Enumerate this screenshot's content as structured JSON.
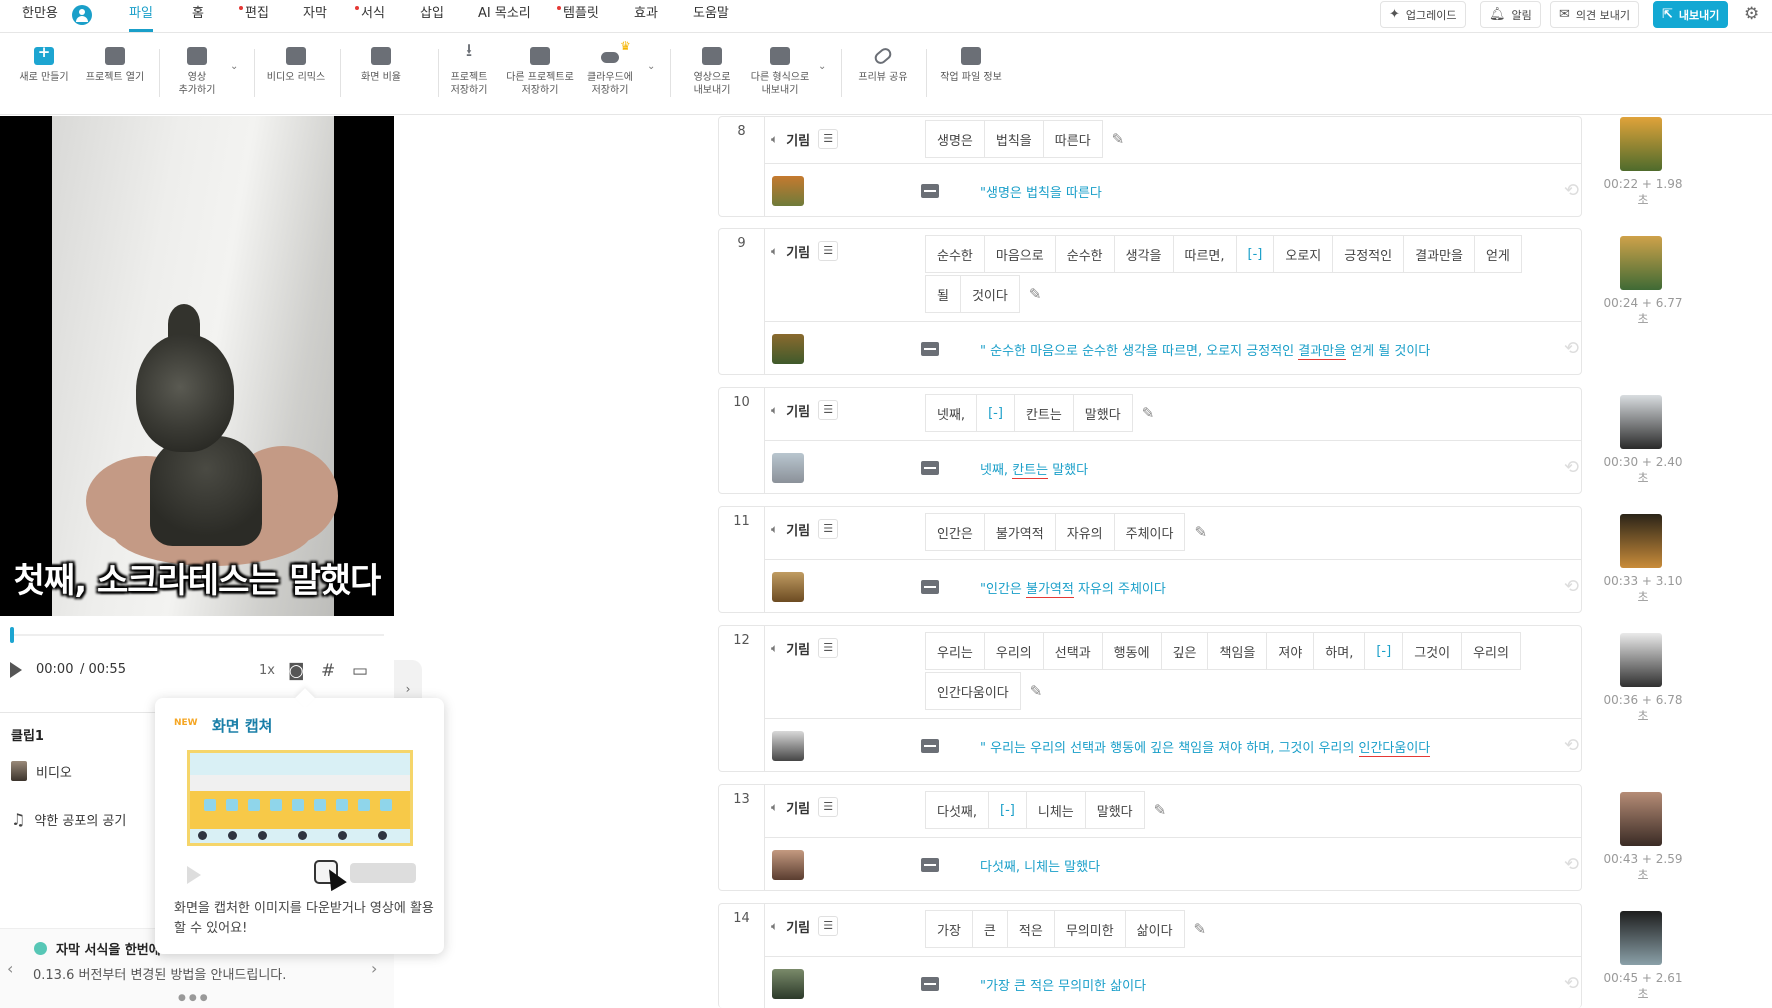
{
  "menubar": {
    "app_label": "한만용",
    "items": [
      {
        "label": "파일",
        "active": true,
        "dot": false
      },
      {
        "label": "홈",
        "active": false,
        "dot": false
      },
      {
        "label": "편집",
        "active": false,
        "dot": true
      },
      {
        "label": "자막",
        "active": false,
        "dot": false
      },
      {
        "label": "서식",
        "active": false,
        "dot": true
      },
      {
        "label": "삽입",
        "active": false,
        "dot": false
      },
      {
        "label": "AI 목소리",
        "active": false,
        "dot": false
      },
      {
        "label": "템플릿",
        "active": false,
        "dot": true
      },
      {
        "label": "효과",
        "active": false,
        "dot": false
      },
      {
        "label": "도움말",
        "active": false,
        "dot": false
      }
    ],
    "upgrade_label": "업그레이드",
    "alert_label": "알림",
    "feedback_label": "의견 보내기",
    "export_label": "내보내기"
  },
  "toolbar": {
    "new": "새로 만들기",
    "open": "프로젝트 열기",
    "add_video_1": "영상",
    "add_video_2": "추가하기",
    "video_remix": "비디오 리믹스",
    "screen_ratio": "화면 비율",
    "save_1": "프로젝트",
    "save_2": "저장하기",
    "save_as_1": "다른 프로젝트로",
    "save_as_2": "저장하기",
    "cloud_1": "클라우드에",
    "cloud_2": "저장하기",
    "export_video_1": "영상으로",
    "export_video_2": "내보내기",
    "export_other_1": "다른 형식으로",
    "export_other_2": "내보내기",
    "preview_share": "프리뷰 공유",
    "file_info": "작업 파일 정보"
  },
  "player": {
    "caption": "첫째, 소크라테스는 말했다",
    "current_time": "00:00",
    "total_time": "/ 00:55",
    "speed": "1x",
    "progress": 0.0
  },
  "clips": {
    "title": "클립1",
    "video_label": "비디오",
    "music_label": "약한 공포의 공기"
  },
  "notice": {
    "title": "자막 서식을 한번에",
    "text": "0.13.6 버전부터 변경된 방법을 안내드립니다."
  },
  "popover": {
    "badge": "NEW",
    "title": "화면 캡쳐",
    "desc": "화면을 캡처한 이미지를 다운받거나 영상에 활용할 수 있어요!"
  },
  "scenes": [
    {
      "num": "8",
      "voice": "기림",
      "lines": [
        [
          "생명은",
          "법칙을",
          "따른다"
        ]
      ],
      "subtitle": "\"생명은 법칙을 따른다",
      "time": "00:22 + 1.98초"
    },
    {
      "num": "9",
      "voice": "기림",
      "lines": [
        [
          "순수한",
          "마음으로",
          "순수한",
          "생각을",
          "따르면,",
          "[-]",
          "오로지",
          "긍정적인",
          "결과만을",
          "얻게"
        ],
        [
          "될",
          "것이다"
        ]
      ],
      "subtitle_a": "\" 순수한 마음으로 순수한 생각을 따르면, 오로지 긍정적인 ",
      "subtitle_ul": "결과만을",
      "subtitle_b": " 얻게 될 것이다",
      "time": "00:24 + 6.77초"
    },
    {
      "num": "10",
      "voice": "기림",
      "lines": [
        [
          "넷째,",
          "[-]",
          "칸트는",
          "말했다"
        ]
      ],
      "subtitle_a": "넷째, ",
      "subtitle_ul": "칸트는",
      "subtitle_b": " 말했다",
      "time": "00:30 + 2.40초"
    },
    {
      "num": "11",
      "voice": "기림",
      "lines": [
        [
          "인간은",
          "불가역적",
          "자유의",
          "주체이다"
        ]
      ],
      "subtitle_a": "\"인간은 ",
      "subtitle_ul": "불가역적",
      "subtitle_b": " 자유의 주체이다",
      "time": "00:33 + 3.10초"
    },
    {
      "num": "12",
      "voice": "기림",
      "lines": [
        [
          "우리는",
          "우리의",
          "선택과",
          "행동에",
          "깊은",
          "책임을",
          "져야",
          "하며,",
          "[-]",
          "그것이",
          "우리의"
        ],
        [
          "인간다움이다"
        ]
      ],
      "subtitle_a": "\" 우리는 우리의 선택과 행동에 깊은 책임을 져야 하며, 그것이 우리의 ",
      "subtitle_ul": "인간다움이다",
      "subtitle_b": "",
      "time": "00:36 + 6.78초"
    },
    {
      "num": "13",
      "voice": "기림",
      "lines": [
        [
          "다섯째,",
          "[-]",
          "니체는",
          "말했다"
        ]
      ],
      "subtitle": "다섯째, 니체는 말했다",
      "time": "00:43 + 2.59초"
    },
    {
      "num": "14",
      "voice": "기림",
      "lines": [
        [
          "가장",
          "큰",
          "적은",
          "무의미한",
          "삶이다"
        ]
      ],
      "subtitle": "\"가장 큰 적은 무의미한 삶이다",
      "time": "00:45 + 2.61초"
    }
  ],
  "colors": {
    "accent": "#1a9fc9",
    "export_btn": "#13a8d3",
    "dot": "#e53935",
    "crown": "#f5b400"
  }
}
